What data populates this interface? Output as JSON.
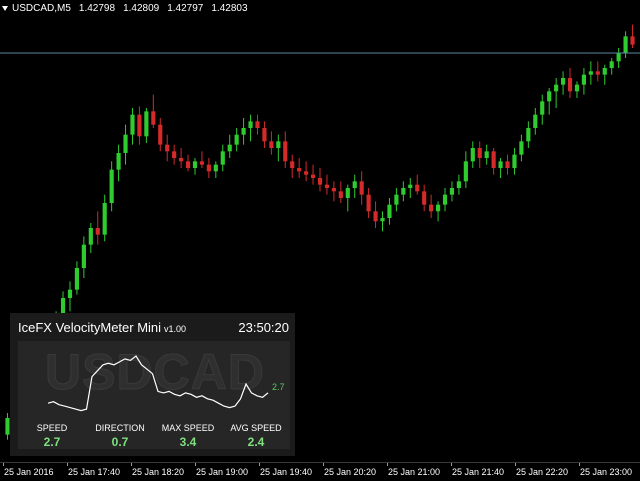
{
  "symbol": {
    "name": "USDCAD,M5",
    "open": "1.42798",
    "high": "1.42809",
    "low": "1.42797",
    "close": "1.42803"
  },
  "colors": {
    "bull": "#2ecc2e",
    "bear": "#d42a2a",
    "price_line": "#5a8aa0",
    "background": "#000000",
    "panel": "#1b1b1b",
    "value_text": "#7ee07e"
  },
  "time_axis": {
    "labels": [
      "25 Jan 2016",
      "25 Jan 17:40",
      "25 Jan 18:20",
      "25 Jan 19:00",
      "25 Jan 19:40",
      "25 Jan 20:20",
      "25 Jan 21:00",
      "25 Jan 21:40",
      "25 Jan 22:20",
      "25 Jan 23:00"
    ]
  },
  "chart_data": {
    "type": "candlestick",
    "price_line": 1.42803,
    "candles": [
      [
        1.4066,
        1.4079,
        1.4063,
        1.4076
      ],
      [
        1.4076,
        1.408,
        1.4062,
        1.4068
      ],
      [
        1.4068,
        1.4074,
        1.406,
        1.407
      ],
      [
        1.407,
        1.408,
        1.4068,
        1.4078
      ],
      [
        1.408,
        1.4095,
        1.4078,
        1.4092
      ],
      [
        1.4092,
        1.411,
        1.409,
        1.4108
      ],
      [
        1.4108,
        1.4125,
        1.4104,
        1.412
      ],
      [
        1.412,
        1.414,
        1.4116,
        1.4135
      ],
      [
        1.4135,
        1.4152,
        1.413,
        1.4148
      ],
      [
        1.4148,
        1.4158,
        1.414,
        1.4153
      ],
      [
        1.4153,
        1.417,
        1.415,
        1.4166
      ],
      [
        1.4166,
        1.4185,
        1.416,
        1.418
      ],
      [
        1.418,
        1.4193,
        1.4175,
        1.419
      ],
      [
        1.419,
        1.42,
        1.418,
        1.4186
      ],
      [
        1.4186,
        1.421,
        1.4182,
        1.4205
      ],
      [
        1.4205,
        1.423,
        1.42,
        1.4225
      ],
      [
        1.4225,
        1.424,
        1.4218,
        1.4235
      ],
      [
        1.4235,
        1.4252,
        1.4228,
        1.4246
      ],
      [
        1.4246,
        1.4262,
        1.424,
        1.4258
      ],
      [
        1.4258,
        1.4263,
        1.424,
        1.4245
      ],
      [
        1.4245,
        1.4262,
        1.4241,
        1.426
      ],
      [
        1.426,
        1.427,
        1.425,
        1.4252
      ],
      [
        1.4252,
        1.4256,
        1.4236,
        1.424
      ],
      [
        1.424,
        1.4246,
        1.423,
        1.4236
      ],
      [
        1.4236,
        1.424,
        1.4228,
        1.4232
      ],
      [
        1.4232,
        1.4238,
        1.4226,
        1.423
      ],
      [
        1.423,
        1.4234,
        1.4224,
        1.4226
      ],
      [
        1.4226,
        1.4232,
        1.4222,
        1.423
      ],
      [
        1.423,
        1.4236,
        1.4226,
        1.4228
      ],
      [
        1.4228,
        1.4232,
        1.422,
        1.4224
      ],
      [
        1.4224,
        1.423,
        1.422,
        1.4228
      ],
      [
        1.4228,
        1.424,
        1.4224,
        1.4236
      ],
      [
        1.4236,
        1.4246,
        1.4232,
        1.424
      ],
      [
        1.424,
        1.425,
        1.4236,
        1.4246
      ],
      [
        1.4246,
        1.4256,
        1.424,
        1.425
      ],
      [
        1.425,
        1.4258,
        1.4242,
        1.4254
      ],
      [
        1.4254,
        1.4258,
        1.4246,
        1.425
      ],
      [
        1.425,
        1.4254,
        1.4238,
        1.4242
      ],
      [
        1.4242,
        1.4248,
        1.4234,
        1.4238
      ],
      [
        1.4238,
        1.4246,
        1.423,
        1.4242
      ],
      [
        1.4242,
        1.4248,
        1.4226,
        1.423
      ],
      [
        1.423,
        1.4234,
        1.422,
        1.4226
      ],
      [
        1.4226,
        1.4232,
        1.422,
        1.4224
      ],
      [
        1.4224,
        1.423,
        1.4218,
        1.4222
      ],
      [
        1.4222,
        1.4228,
        1.4216,
        1.422
      ],
      [
        1.422,
        1.4226,
        1.4212,
        1.4216
      ],
      [
        1.4216,
        1.4222,
        1.421,
        1.4214
      ],
      [
        1.4214,
        1.4218,
        1.4206,
        1.4212
      ],
      [
        1.4212,
        1.4218,
        1.4205,
        1.4208
      ],
      [
        1.4208,
        1.4216,
        1.42,
        1.4214
      ],
      [
        1.4214,
        1.4222,
        1.4208,
        1.4218
      ],
      [
        1.4218,
        1.4224,
        1.4204,
        1.421
      ],
      [
        1.421,
        1.4214,
        1.4196,
        1.42
      ],
      [
        1.42,
        1.4206,
        1.419,
        1.4194
      ],
      [
        1.4194,
        1.42,
        1.4188,
        1.4196
      ],
      [
        1.4196,
        1.4208,
        1.4192,
        1.4204
      ],
      [
        1.4204,
        1.4214,
        1.42,
        1.421
      ],
      [
        1.421,
        1.4218,
        1.4206,
        1.4214
      ],
      [
        1.4214,
        1.422,
        1.4208,
        1.4216
      ],
      [
        1.4216,
        1.4222,
        1.421,
        1.4212
      ],
      [
        1.4212,
        1.4216,
        1.42,
        1.4204
      ],
      [
        1.4204,
        1.421,
        1.4196,
        1.42
      ],
      [
        1.42,
        1.4206,
        1.4194,
        1.4204
      ],
      [
        1.4204,
        1.4214,
        1.42,
        1.421
      ],
      [
        1.421,
        1.4218,
        1.4206,
        1.4214
      ],
      [
        1.4214,
        1.4222,
        1.421,
        1.4218
      ],
      [
        1.4218,
        1.4236,
        1.4214,
        1.423
      ],
      [
        1.423,
        1.4242,
        1.4226,
        1.4238
      ],
      [
        1.4238,
        1.4242,
        1.4226,
        1.4232
      ],
      [
        1.4232,
        1.424,
        1.4228,
        1.4236
      ],
      [
        1.4236,
        1.4238,
        1.4222,
        1.4226
      ],
      [
        1.4226,
        1.4232,
        1.422,
        1.423
      ],
      [
        1.423,
        1.4234,
        1.4222,
        1.4226
      ],
      [
        1.4226,
        1.4238,
        1.4222,
        1.4234
      ],
      [
        1.4234,
        1.4246,
        1.423,
        1.4242
      ],
      [
        1.4242,
        1.4254,
        1.4238,
        1.425
      ],
      [
        1.425,
        1.4262,
        1.4246,
        1.4258
      ],
      [
        1.4258,
        1.427,
        1.4252,
        1.4266
      ],
      [
        1.4266,
        1.4274,
        1.4258,
        1.4272
      ],
      [
        1.4272,
        1.428,
        1.4262,
        1.4276
      ],
      [
        1.4276,
        1.4284,
        1.427,
        1.428
      ],
      [
        1.428,
        1.4286,
        1.4268,
        1.4272
      ],
      [
        1.4272,
        1.4278,
        1.4268,
        1.4276
      ],
      [
        1.4276,
        1.4286,
        1.427,
        1.4282
      ],
      [
        1.4282,
        1.429,
        1.4276,
        1.4284
      ],
      [
        1.4284,
        1.429,
        1.4278,
        1.4282
      ],
      [
        1.4282,
        1.4288,
        1.4276,
        1.4286
      ],
      [
        1.4286,
        1.4292,
        1.4282,
        1.429
      ],
      [
        1.429,
        1.4298,
        1.4286,
        1.4295
      ],
      [
        1.4295,
        1.4308,
        1.4292,
        1.4305
      ],
      [
        1.4305,
        1.4312,
        1.4298,
        1.43
      ]
    ]
  },
  "velocity_meter": {
    "title": "IceFX VelocityMeter Mini",
    "version": "v1.00",
    "clock": "23:50:20",
    "watermark": "USDCAD",
    "current_speed_tag": "2.7",
    "speed_trace": [
      2.0,
      2.1,
      1.9,
      1.8,
      1.7,
      1.6,
      1.5,
      1.6,
      3.8,
      4.2,
      4.6,
      4.7,
      4.6,
      4.8,
      5.0,
      4.9,
      5.2,
      4.6,
      4.3,
      4.0,
      2.8,
      2.7,
      2.8,
      2.6,
      2.5,
      2.7,
      2.6,
      2.4,
      2.5,
      2.3,
      2.2,
      2.0,
      1.8,
      1.7,
      1.8,
      2.3,
      3.3,
      2.7,
      2.5,
      2.4,
      2.7
    ],
    "stats": [
      {
        "label": "SPEED",
        "value": "2.7"
      },
      {
        "label": "DIRECTION",
        "value": "0.7"
      },
      {
        "label": "MAX SPEED",
        "value": "3.4"
      },
      {
        "label": "AVG SPEED",
        "value": "2.4"
      }
    ]
  }
}
